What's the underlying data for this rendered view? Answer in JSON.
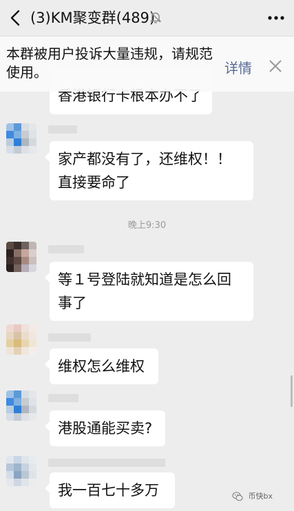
{
  "header": {
    "title": "(3)KM聚变群(489)"
  },
  "notice": {
    "text": "本群被用户投诉大量违规，请规范使用。",
    "link_label": "详情"
  },
  "messages": [
    {
      "text": "香港银行卡根本办不了"
    },
    {
      "text": "家产都没有了，还维权！！直接要命了"
    },
    {
      "text": "等１号登陆就知道是怎么回事了"
    },
    {
      "text": "维权怎么维权"
    },
    {
      "text": "港股通能买卖?"
    },
    {
      "text": "我一百七十多万"
    }
  ],
  "timestamp": "晚上9:30",
  "watermark": "币快bx",
  "colors": {
    "background": "#ededed",
    "bubble": "#ffffff",
    "link": "#576b95"
  }
}
